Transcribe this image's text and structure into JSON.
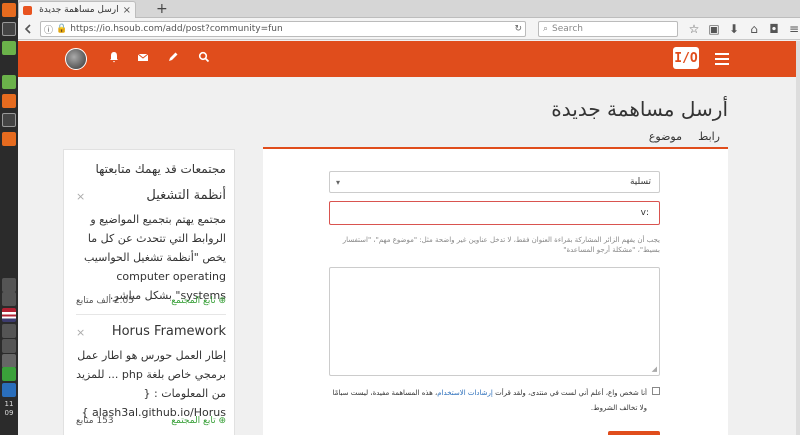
{
  "browser": {
    "tab_title": "أرسل مساهمة جديدة - ح...",
    "tab_close": "×",
    "new_tab": "+",
    "url": "https://io.hsoub.com/add/post?community=fun",
    "search_placeholder": "Search"
  },
  "dock": {
    "clock_hour": "11",
    "clock_min": "09"
  },
  "site": {
    "logo_text": "I/O"
  },
  "page": {
    "title": "أرسل مساهمة جديدة",
    "tabs": [
      {
        "label": "رابط"
      },
      {
        "label": "موضوع"
      }
    ]
  },
  "sidebar": {
    "title": "مجتمعات قد يهمك متابعتها",
    "cards": [
      {
        "name": "أنظمة التشغيل",
        "description": "مجتمع يهتم بتجميع المواضيع و الروابط التي تتحدث عن كل ما يخص \"أنظمة تشغيل الحواسيب computer operating systems\" بشكل مباشر.",
        "follow": "تابع المجتمع",
        "count": "2.05 ألف متابع"
      },
      {
        "name": "Horus Framework",
        "description": "إطار العمل حورس هو اطار عمل برمجي خاص بلغة php ... للمزيد من المعلومات : { alash3al.github.io/Horus }",
        "follow": "تابع المجتمع",
        "count": "153 متابع"
      }
    ]
  },
  "form": {
    "community_value": "تسلية",
    "title_value": ":v",
    "hint": "يجب أن يفهم الزائر المشاركة بقراءة العنوان فقط، لا تدخل عناوين غير واضحة مثل: \"موضوع مهم\"، \"استفسار بسيط\"، \"مشكلة أرجو المساعدة\"",
    "agree_prefix": "أنا شخص واع، أعلم أني لست في منتدى، ولقد قرأت",
    "agree_link": "إرشادات الاستخدام",
    "agree_suffix": "، هذه المساهمة مفيدة، ليست سبامًا ولا تخالف الشروط."
  },
  "colors": {
    "brand": "#e04d1c",
    "follow_green": "#3aa13a",
    "error_border": "#d9534f"
  }
}
